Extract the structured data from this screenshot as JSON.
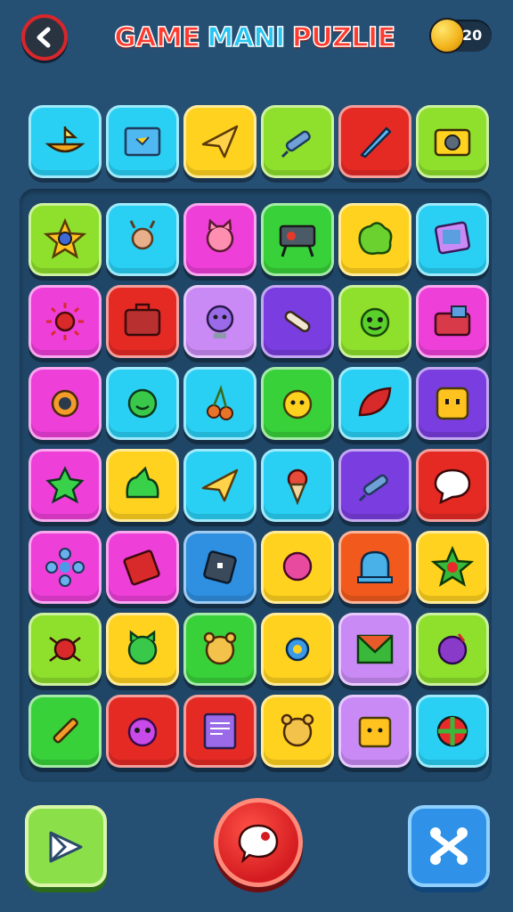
{
  "header": {
    "title_part1": "GAME",
    "title_part2": "MANI",
    "title_part3": "PUZLIE",
    "coins": "20"
  },
  "colors": {
    "background": "#254f73",
    "cyan": "#29d0f4",
    "yellow": "#ffd21f",
    "lime": "#8ee02c",
    "green": "#38d13a",
    "red": "#e52a24",
    "magenta": "#ee3fd9",
    "purple": "#7a3de0",
    "lavender": "#c98af5",
    "blue": "#2f8fe0",
    "orange": "#f25a1d"
  },
  "top_row": [
    {
      "color": "cyan",
      "icon": "boat-icon"
    },
    {
      "color": "cyan",
      "icon": "treasure-map-icon"
    },
    {
      "color": "yellow",
      "icon": "paper-plane-icon"
    },
    {
      "color": "lime",
      "icon": "syringe-icon"
    },
    {
      "color": "red",
      "icon": "rocket-icon"
    },
    {
      "color": "lime",
      "icon": "camera-icon"
    }
  ],
  "grid": [
    [
      {
        "color": "lime",
        "icon": "star-creature-icon"
      },
      {
        "color": "cyan",
        "icon": "deer-icon"
      },
      {
        "color": "magenta",
        "icon": "pink-cat-icon"
      },
      {
        "color": "green",
        "icon": "projector-icon"
      },
      {
        "color": "yellow",
        "icon": "green-blob-icon"
      },
      {
        "color": "cyan",
        "icon": "tablet-icon"
      }
    ],
    [
      {
        "color": "magenta",
        "icon": "red-sun-icon"
      },
      {
        "color": "red",
        "icon": "suitcase-icon"
      },
      {
        "color": "lavender",
        "icon": "purple-face-icon"
      },
      {
        "color": "purple",
        "icon": "bone-icon"
      },
      {
        "color": "lime",
        "icon": "green-monster-icon"
      },
      {
        "color": "magenta",
        "icon": "bag-icon"
      }
    ],
    [
      {
        "color": "magenta",
        "icon": "gear-eye-icon"
      },
      {
        "color": "cyan",
        "icon": "green-smile-icon"
      },
      {
        "color": "cyan",
        "icon": "cherries-icon"
      },
      {
        "color": "green",
        "icon": "yellow-bear-icon"
      },
      {
        "color": "cyan",
        "icon": "red-leaf-icon"
      },
      {
        "color": "purple",
        "icon": "yellow-square-face-icon"
      }
    ],
    [
      {
        "color": "magenta",
        "icon": "green-star-blob-icon"
      },
      {
        "color": "yellow",
        "icon": "green-slime-icon"
      },
      {
        "color": "cyan",
        "icon": "paper-plane-icon"
      },
      {
        "color": "cyan",
        "icon": "ice-cream-icon"
      },
      {
        "color": "purple",
        "icon": "syringe-icon"
      },
      {
        "color": "red",
        "icon": "chat-bubble-icon"
      }
    ],
    [
      {
        "color": "magenta",
        "icon": "flower-icon"
      },
      {
        "color": "magenta",
        "icon": "book-icon"
      },
      {
        "color": "blue",
        "icon": "device-icon"
      },
      {
        "color": "yellow",
        "icon": "pink-ball-icon"
      },
      {
        "color": "orange",
        "icon": "bell-jar-icon"
      },
      {
        "color": "yellow",
        "icon": "green-star-icon"
      }
    ],
    [
      {
        "color": "lime",
        "icon": "red-bug-icon"
      },
      {
        "color": "yellow",
        "icon": "green-cat-icon"
      },
      {
        "color": "green",
        "icon": "bear-face-icon"
      },
      {
        "color": "yellow",
        "icon": "blue-gear-icon"
      },
      {
        "color": "lavender",
        "icon": "envelope-icon"
      },
      {
        "color": "lime",
        "icon": "purple-ball-icon"
      }
    ],
    [
      {
        "color": "green",
        "icon": "pen-icon"
      },
      {
        "color": "red",
        "icon": "pink-monster-icon"
      },
      {
        "color": "red",
        "icon": "document-icon"
      },
      {
        "color": "yellow",
        "icon": "bear-face-icon"
      },
      {
        "color": "lavender",
        "icon": "yellow-box-face-icon"
      },
      {
        "color": "cyan",
        "icon": "beach-ball-icon"
      }
    ]
  ],
  "controls": {
    "left_icon": "mail-icon",
    "center_icon": "speech-bubble-icon",
    "right_icon": "shuffle-icon"
  }
}
